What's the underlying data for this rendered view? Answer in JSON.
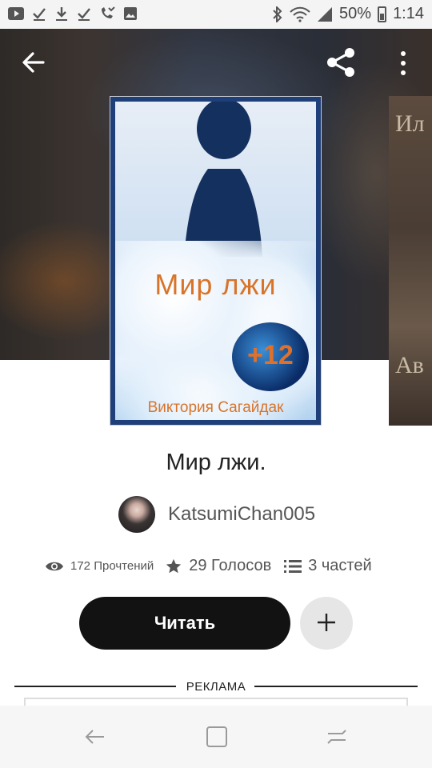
{
  "status_bar": {
    "battery": "50%",
    "time": "1:14",
    "icons": [
      "youtube-icon",
      "check-icon",
      "download-icon",
      "check-icon",
      "missed-call-icon",
      "image-icon",
      "bluetooth-icon",
      "wifi-icon",
      "signal-icon",
      "battery-icon"
    ]
  },
  "toolbar": {
    "back_icon": "arrow-back-icon",
    "share_icon": "share-icon",
    "more_icon": "more-vertical-icon"
  },
  "cover": {
    "title": "Мир лжи",
    "badge": "+12",
    "author": "Виктория Сагайдак"
  },
  "side_cover": {
    "top_text": "Ил",
    "bottom_text": "Ав"
  },
  "book": {
    "title": "Мир лжи.",
    "author": "KatsumiChan005"
  },
  "stats": {
    "reads": "172 Прочтений",
    "votes": "29 Голосов",
    "parts": "3 частей"
  },
  "actions": {
    "read_label": "Читать",
    "add_icon": "plus-icon"
  },
  "ad": {
    "label": "РЕКЛАМА"
  },
  "navbar": {
    "icons": [
      "back-nav-icon",
      "home-nav-icon",
      "recents-nav-icon"
    ]
  },
  "colors": {
    "cover_accent": "#d8742a",
    "button_dark": "#121212",
    "add_button_bg": "#e6e6e6"
  }
}
